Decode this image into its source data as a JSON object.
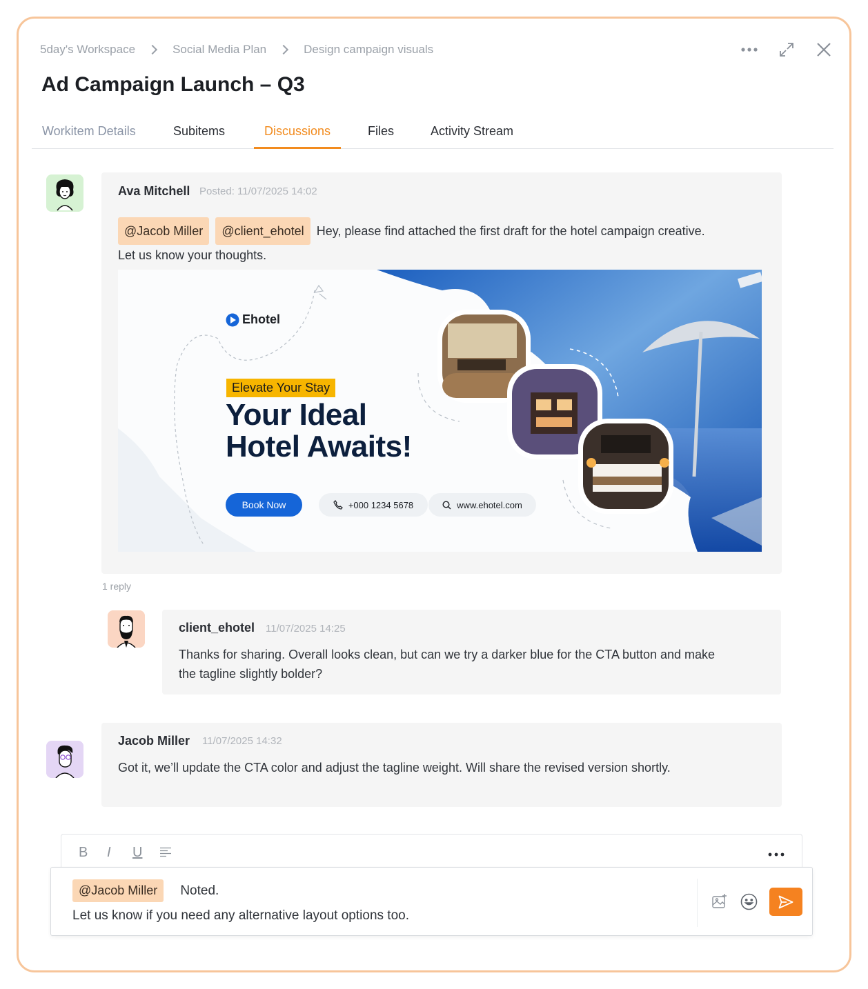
{
  "breadcrumb": [
    "5day's Workspace",
    "Social Media Plan",
    "Design campaign visuals"
  ],
  "title": "Ad Campaign Launch – Q3",
  "tabs": [
    "Workitem Details",
    "Subitems",
    "Discussions",
    "Files",
    "Activity Stream"
  ],
  "active_tab": "Discussions",
  "messages": [
    {
      "author": "Ava Mitchell",
      "meta": "Posted: 11/07/2025 14:02",
      "mentions": [
        "@Jacob Miller",
        "@client_ehotel"
      ],
      "text_line1": "Hey, please find attached the first draft for the hotel campaign creative.",
      "text_line2": "Let us know your thoughts.",
      "reply_count": "1 reply"
    },
    {
      "author": "client_ehotel",
      "meta": "11/07/2025 14:25",
      "text_line1": "Thanks for sharing. Overall looks clean, but can we try a darker blue for the CTA button and make",
      "text_line2": "the tagline slightly bolder?"
    },
    {
      "author": "Jacob Miller",
      "meta": "11/07/2025 14:32",
      "text_line1": "Got it, we’ll update the CTA color and adjust the tagline weight. Will share the revised version shortly."
    }
  ],
  "ad": {
    "brand": "Ehotel",
    "tag": "Elevate Your Stay",
    "headline_line1": "Your Ideal",
    "headline_line2": "Hotel Awaits!",
    "cta": "Book Now",
    "phone": "+000 1234 5678",
    "website": "www.ehotel.com"
  },
  "composer": {
    "mention": "@Jacob Miller",
    "line1": "Noted.",
    "line2": "Let us know if you need any alternative layout options too.",
    "tools": [
      "B",
      "I",
      "U"
    ]
  },
  "colors": {
    "accent": "#f28b1e",
    "frame_border": "#f7c59a",
    "mention_bg": "#fbd7b5",
    "ad_blue": "#1565d8",
    "send": "#f58220"
  }
}
